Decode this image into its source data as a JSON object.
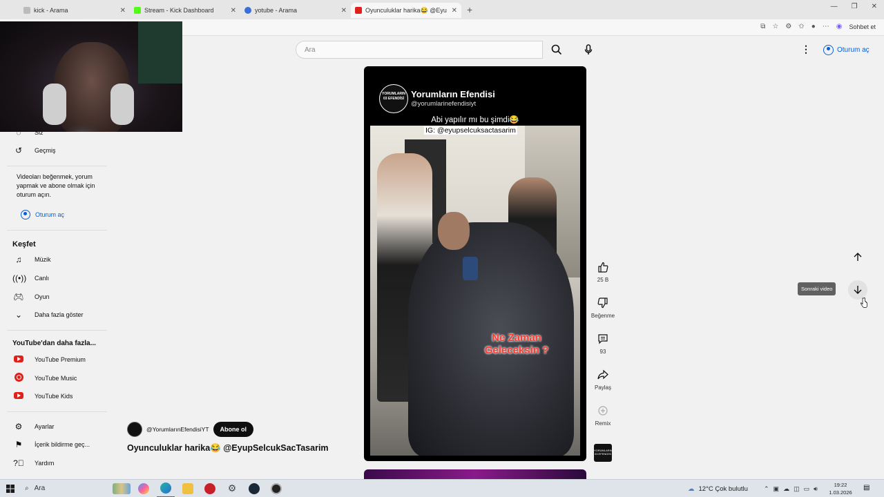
{
  "browser": {
    "tabs": [
      {
        "title": "kick - Arama",
        "favicon_color": "#8a8a8a",
        "active": false
      },
      {
        "title": "Stream - Kick Dashboard",
        "favicon_color": "#53fc18",
        "active": false
      },
      {
        "title": "yotube - Arama",
        "favicon_color": "#3a6fd8",
        "active": false
      },
      {
        "title": "Oyunculuklar harika😂 @Eyu",
        "favicon_color": "#e0201b",
        "active": true
      }
    ],
    "new_tab": "+",
    "chat_button": "Sohbet et"
  },
  "search": {
    "placeholder": "Ara"
  },
  "header": {
    "signin_label": "Oturum aç"
  },
  "sidebar": {
    "you_label": "Siz",
    "history_label": "Geçmiş",
    "signin_note": "Videoları beğenmek, yorum yapmak ve abone olmak için oturum açın.",
    "signin_button": "Oturum aç",
    "explore_title": "Keşfet",
    "explore_items": [
      {
        "label": "Müzik",
        "icon": "music-note-icon"
      },
      {
        "label": "Canlı",
        "icon": "live-icon"
      },
      {
        "label": "Oyun",
        "icon": "gamepad-icon"
      },
      {
        "label": "Daha fazla göster",
        "icon": "chevron-down-icon"
      }
    ],
    "more_title": "YouTube'dan daha fazla...",
    "more_items": [
      {
        "label": "YouTube Premium",
        "icon": "youtube-premium-icon"
      },
      {
        "label": "YouTube Music",
        "icon": "youtube-music-icon"
      },
      {
        "label": "YouTube Kids",
        "icon": "youtube-kids-icon"
      }
    ],
    "footer_items": [
      {
        "label": "Ayarlar",
        "icon": "gear-icon"
      },
      {
        "label": "İçerik bildirme geç...",
        "icon": "flag-icon"
      },
      {
        "label": "Yardım",
        "icon": "help-icon"
      }
    ]
  },
  "video": {
    "channel_name": "Yorumların Efendisi",
    "channel_handle": "@yorumlarinefendisiyt",
    "caption_line1": "Abi yapılır mı bu şimdi😂",
    "caption_line2": "IG: @eyupselcuksactasarim",
    "overlay_text": "Ne Zaman Geleceksin ?",
    "logo_text": "YORUMLARIN 03 EFENDİSİ"
  },
  "actions": {
    "like_count": "25 B",
    "dislike_label": "Beğenme",
    "comments_count": "93",
    "share_label": "Paylaş",
    "remix_label": "Remix"
  },
  "navigation": {
    "next_tooltip": "Sonraki video"
  },
  "meta": {
    "channel_handle": "@YorumlarınEfendisiYT",
    "subscribe_label": "Abone ol",
    "title": "Oyunculuklar harika😂 @EyupSelcukSacTasarim"
  },
  "taskbar": {
    "search_label": "Ara",
    "weather": "12°C  Çok bulutlu",
    "time": "19:22",
    "date": "1.03.2026"
  }
}
